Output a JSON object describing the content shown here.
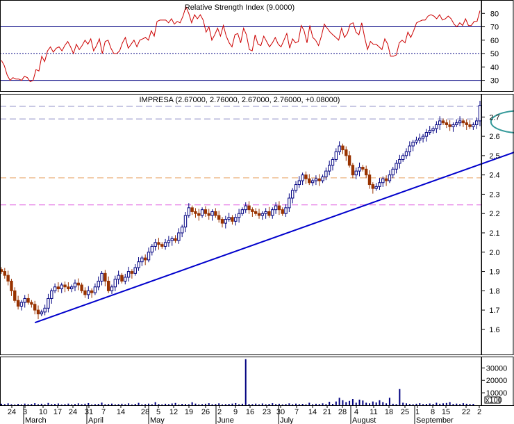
{
  "chart_data": [
    {
      "type": "line",
      "panel": "rsi",
      "title": "Relative Strength Index (9.0000)",
      "ylim": [
        22,
        90
      ],
      "yticks": [
        30,
        40,
        50,
        60,
        70,
        80
      ],
      "reference_lines": [
        {
          "value": 70,
          "style": "solid",
          "color": "#000080"
        },
        {
          "value": 50,
          "style": "dotted",
          "color": "#000080"
        },
        {
          "value": 30,
          "style": "solid",
          "color": "#000080"
        }
      ],
      "series": [
        {
          "color": "#cc0000",
          "values": [
            45,
            41,
            34,
            30,
            32,
            31,
            31,
            30,
            33,
            32,
            29,
            30,
            38,
            37,
            48,
            44,
            52,
            55,
            51,
            54,
            55,
            52,
            56,
            59,
            55,
            50,
            57,
            53,
            56,
            60,
            57,
            61,
            52,
            56,
            61,
            50,
            59,
            60,
            54,
            50,
            50,
            52,
            58,
            62,
            54,
            57,
            60,
            55,
            60,
            61,
            62,
            60,
            67,
            63,
            74,
            75,
            75,
            75,
            73,
            76,
            72,
            74,
            73,
            78,
            85,
            80,
            73,
            79,
            76,
            79,
            75,
            66,
            70,
            60,
            64,
            69,
            63,
            71,
            63,
            58,
            55,
            64,
            65,
            58,
            69,
            64,
            53,
            52,
            64,
            57,
            56,
            63,
            59,
            55,
            58,
            62,
            57,
            55,
            60,
            65,
            54,
            61,
            58,
            59,
            71,
            67,
            58,
            71,
            62,
            60,
            56,
            63,
            72,
            69,
            66,
            64,
            62,
            60,
            69,
            62,
            65,
            72,
            73,
            66,
            64,
            73,
            62,
            53,
            59,
            57,
            57,
            55,
            53,
            61,
            57,
            48,
            48,
            49,
            58,
            60,
            58,
            66,
            62,
            67,
            73,
            74,
            75,
            75,
            78,
            79,
            78,
            76,
            79,
            75,
            76,
            78,
            76,
            72,
            70,
            73,
            71,
            76,
            71,
            71,
            74,
            74,
            82
          ]
        }
      ]
    },
    {
      "type": "candlestick",
      "panel": "price",
      "title": "IMPRESA (2.67000, 2.76000, 2.67000, 2.76000, +0.08000)",
      "ylim": [
        1.47,
        2.82
      ],
      "yticks": [
        1.6,
        1.7,
        1.8,
        1.9,
        2.0,
        2.1,
        2.2,
        2.3,
        2.4,
        2.5,
        2.6,
        2.7
      ],
      "up_color": "#000080",
      "down_color": "#993300",
      "reference_lines": [
        {
          "value": 2.755,
          "style": "dashed",
          "color": "#9090c8"
        },
        {
          "value": 2.69,
          "style": "dashed",
          "color": "#9090c8"
        },
        {
          "value": 2.385,
          "style": "dashed",
          "color": "#e6a060"
        },
        {
          "value": 2.245,
          "style": "dashed",
          "color": "#e060e0"
        }
      ],
      "trendline": {
        "from": [
          10,
          1.635
        ],
        "to": [
          165,
          2.59
        ],
        "color": "#0000cc"
      },
      "highlight_ellipse": {
        "center_index": 155,
        "center_price": 2.675,
        "color": "#339999"
      },
      "close": [
        1.9,
        1.88,
        1.85,
        1.8,
        1.75,
        1.72,
        1.74,
        1.76,
        1.74,
        1.73,
        1.7,
        1.68,
        1.69,
        1.71,
        1.76,
        1.8,
        1.82,
        1.81,
        1.83,
        1.82,
        1.81,
        1.82,
        1.84,
        1.83,
        1.8,
        1.78,
        1.8,
        1.79,
        1.82,
        1.85,
        1.89,
        1.85,
        1.8,
        1.82,
        1.86,
        1.88,
        1.85,
        1.87,
        1.9,
        1.89,
        1.92,
        1.95,
        1.97,
        1.96,
        2.0,
        2.03,
        2.05,
        2.04,
        2.03,
        2.05,
        2.06,
        2.07,
        2.06,
        2.1,
        2.13,
        2.19,
        2.23,
        2.21,
        2.2,
        2.19,
        2.22,
        2.2,
        2.19,
        2.21,
        2.19,
        2.17,
        2.15,
        2.17,
        2.18,
        2.16,
        2.18,
        2.2,
        2.22,
        2.24,
        2.22,
        2.21,
        2.2,
        2.19,
        2.2,
        2.21,
        2.19,
        2.22,
        2.24,
        2.22,
        2.2,
        2.23,
        2.28,
        2.32,
        2.35,
        2.37,
        2.4,
        2.38,
        2.36,
        2.37,
        2.38,
        2.37,
        2.39,
        2.42,
        2.45,
        2.48,
        2.52,
        2.55,
        2.53,
        2.5,
        2.45,
        2.4,
        2.42,
        2.44,
        2.43,
        2.4,
        2.35,
        2.33,
        2.34,
        2.36,
        2.38,
        2.37,
        2.4,
        2.43,
        2.46,
        2.48,
        2.5,
        2.52,
        2.55,
        2.57,
        2.58,
        2.59,
        2.6,
        2.62,
        2.63,
        2.64,
        2.66,
        2.68,
        2.67,
        2.66,
        2.65,
        2.66,
        2.67,
        2.68,
        2.67,
        2.66,
        2.65,
        2.66,
        2.68,
        2.76
      ],
      "x_tick_labels": [
        "24",
        "3",
        "10",
        "17",
        "24",
        "31",
        "7",
        "14",
        "28",
        "5",
        "12",
        "19",
        "26",
        "2",
        "9",
        "16",
        "23",
        "30",
        "7",
        "14",
        "21",
        "28",
        "4",
        "11",
        "18",
        "25",
        "1",
        "8",
        "15",
        "22",
        "2"
      ],
      "x_tick_positions": [
        17,
        36,
        62,
        83,
        105,
        128,
        149,
        174,
        209,
        228,
        250,
        272,
        296,
        316,
        339,
        360,
        384,
        404,
        427,
        450,
        471,
        493,
        513,
        538,
        560,
        583,
        601,
        623,
        642,
        671,
        690
      ],
      "month_labels": [
        "March",
        "April",
        "May",
        "June",
        "July",
        "August",
        "September"
      ],
      "month_positions": [
        34,
        125,
        214,
        311,
        401,
        505,
        597
      ]
    },
    {
      "type": "bar",
      "panel": "volume",
      "yticks": [
        10000,
        20000,
        30000
      ],
      "scale_note": "x100",
      "ylim": [
        0,
        38000
      ],
      "spikes": [
        {
          "index": 73,
          "value": 37000
        },
        {
          "index": 125,
          "value": 13000
        }
      ],
      "baseline_values": [
        1200,
        900,
        1500,
        800,
        600,
        1100,
        700,
        1300,
        900,
        1000,
        1600,
        800,
        1200,
        700,
        1800,
        900,
        1100,
        1400,
        600,
        900,
        1300,
        700,
        1000,
        1500,
        800,
        1200,
        1700,
        600,
        900,
        1100,
        2100,
        800,
        1000,
        1300,
        700,
        900,
        1200,
        800,
        1500,
        600,
        1100,
        1900,
        700,
        900,
        1300,
        800,
        2500,
        1000,
        700,
        1200,
        900,
        1400,
        1800,
        600,
        1100,
        1000,
        800,
        2400,
        1300,
        700,
        900,
        1200,
        1600,
        800,
        1000,
        1500,
        700,
        900,
        1100,
        1300,
        1700,
        800,
        1200,
        37000,
        1000,
        900,
        1300,
        700,
        1400,
        800,
        1100,
        1600,
        900,
        1200,
        700,
        1000,
        1500,
        800,
        1300,
        900,
        1100,
        700,
        2000,
        800,
        1200,
        1000,
        1500,
        900,
        2800,
        1100,
        3000,
        6000,
        4000,
        2500,
        3500,
        5000,
        2000,
        4500,
        3800,
        2000,
        1500,
        3000,
        2200,
        4000,
        2500,
        1500,
        6000,
        1200,
        900,
        13000,
        2000,
        1500,
        1000,
        800,
        1200,
        1600,
        900,
        1100,
        1400,
        1000,
        2000,
        1200,
        1500,
        1800,
        2500,
        1000,
        1300,
        900,
        1600,
        1200,
        1000,
        1100
      ]
    }
  ]
}
